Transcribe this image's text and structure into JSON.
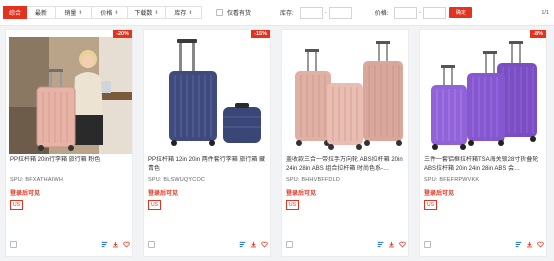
{
  "toolbar": {
    "tabs": [
      {
        "label": "综合",
        "active": true,
        "arrow": ""
      },
      {
        "label": "最新",
        "active": false,
        "arrow": ""
      },
      {
        "label": "销量",
        "active": false,
        "arrow": "⬍"
      },
      {
        "label": "价格",
        "active": false,
        "arrow": "⬍"
      },
      {
        "label": "下载数",
        "active": false,
        "arrow": "⬍"
      },
      {
        "label": "库存",
        "active": false,
        "arrow": "⬍"
      }
    ],
    "in_stock_label": "仅看有货",
    "stock_label": "库存:",
    "price_label": "价格:",
    "dash": "-",
    "confirm_label": "确定",
    "page_indicator": "1/1"
  },
  "colors": {
    "accent": "#e5321f"
  },
  "products": [
    {
      "discount": "-20%",
      "title": "PP拉杆箱 20in行李箱 旅行箱 粉色",
      "spu": "SPU:  BFXATHAIWH",
      "price": "登录后可见",
      "tag": "US",
      "image": "pink-luggage-with-woman"
    },
    {
      "discount": "-15%",
      "title": "PP拉杆箱 12in 20in 两件套行李箱 旅行箱 藏青色",
      "spu": "SPU:  BLSWUQYCOC",
      "price": "登录后可见",
      "tag": "US",
      "image": "navy-luggage-set"
    },
    {
      "discount": "",
      "title": "盖收款三合一带拉手万向轮 ABS拉杆箱 20in 24in 28in ABS 组合拉杆箱 时尚色系-…",
      "spu": "SPU:  BHHVBFFDLD",
      "price": "登录后可见",
      "tag": "US",
      "image": "rose-gold-luggage-set"
    },
    {
      "discount": "-8%",
      "title": "三件一套铝框拉杆箱TSA海关锁28寸折叠轮 ABS拉杆箱 20in 24in 28in ABS 会…",
      "spu": "SPU:  BFEFRPWVKK",
      "price": "登录后可见",
      "tag": "US",
      "image": "purple-luggage-set"
    }
  ]
}
